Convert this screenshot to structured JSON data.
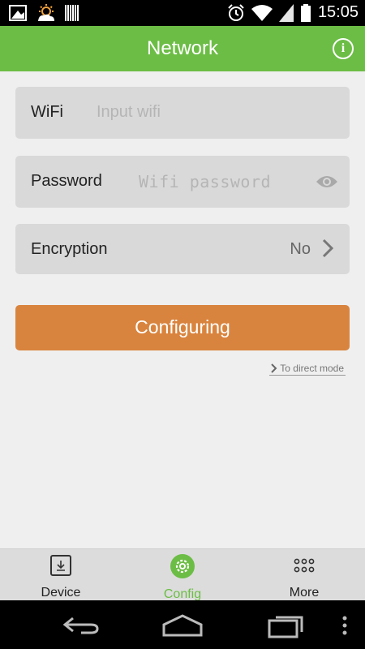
{
  "status_bar": {
    "time": "15:05"
  },
  "app_bar": {
    "title": "Network",
    "info_symbol": "i"
  },
  "form": {
    "wifi": {
      "label": "WiFi",
      "placeholder": "Input wifi"
    },
    "password": {
      "label": "Password",
      "placeholder": "Wifi password"
    },
    "encryption": {
      "label": "Encryption",
      "value": "No"
    }
  },
  "primary_button": {
    "label": "Configuring"
  },
  "direct_mode_link": {
    "label": "To direct mode"
  },
  "tabs": [
    {
      "label": "Device",
      "icon": "device-icon",
      "active": false
    },
    {
      "label": "Config",
      "icon": "gear-icon",
      "active": true
    },
    {
      "label": "More",
      "icon": "grid-dots-icon",
      "active": false
    }
  ],
  "colors": {
    "brand_green": "#6cbd45",
    "button_orange": "#d9843e",
    "field_bg": "#d9d9d9",
    "background": "#efefef"
  }
}
